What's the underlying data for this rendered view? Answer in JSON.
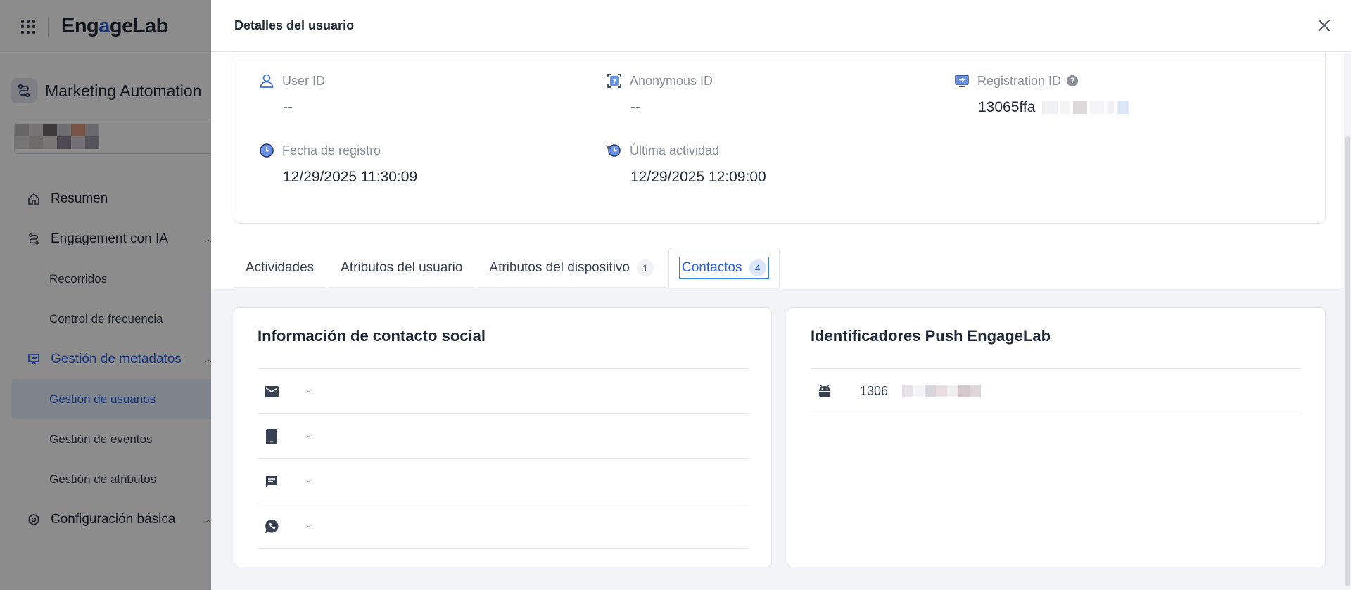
{
  "app": {
    "logo": {
      "part1": "Eng",
      "part2": "a",
      "part3": "geLab"
    },
    "product_name": "Marketing Automation",
    "nav": [
      {
        "label": "Resumen"
      },
      {
        "label": "Engagement con IA"
      },
      {
        "label": "Recorridos"
      },
      {
        "label": "Control de frecuencia"
      },
      {
        "label": "Gestión de metadatos"
      },
      {
        "label": "Gestión de usuarios"
      },
      {
        "label": "Gestión de eventos"
      },
      {
        "label": "Gestión de atributos"
      },
      {
        "label": "Configuración básica"
      }
    ]
  },
  "drawer": {
    "title": "Detalles del usuario",
    "fields": {
      "user_id": {
        "label": "User ID",
        "value": "--"
      },
      "anonymous_id": {
        "label": "Anonymous ID",
        "value": "--"
      },
      "registration_id": {
        "label": "Registration ID",
        "value": "13065ffa"
      },
      "fecha_registro": {
        "label": "Fecha de registro",
        "value": "12/29/2025 11:30:09"
      },
      "ultima_actividad": {
        "label": "Última actividad",
        "value": "12/29/2025 12:09:00"
      }
    },
    "tabs": [
      {
        "label": "Actividades",
        "badge": ""
      },
      {
        "label": "Atributos del usuario",
        "badge": ""
      },
      {
        "label": "Atributos del dispositivo",
        "badge": "1"
      },
      {
        "label": "Contactos",
        "badge": "4"
      }
    ],
    "social_card": {
      "title": "Información de contacto social",
      "rows": [
        {
          "icon": "mail-icon",
          "value": "-"
        },
        {
          "icon": "phone-icon",
          "value": "-"
        },
        {
          "icon": "sms-icon",
          "value": "-"
        },
        {
          "icon": "whatsapp-icon",
          "value": "-"
        }
      ]
    },
    "push_card": {
      "title": "Identificadores Push EngageLab",
      "rows": [
        {
          "icon": "android-icon",
          "value": "1306"
        }
      ]
    }
  }
}
